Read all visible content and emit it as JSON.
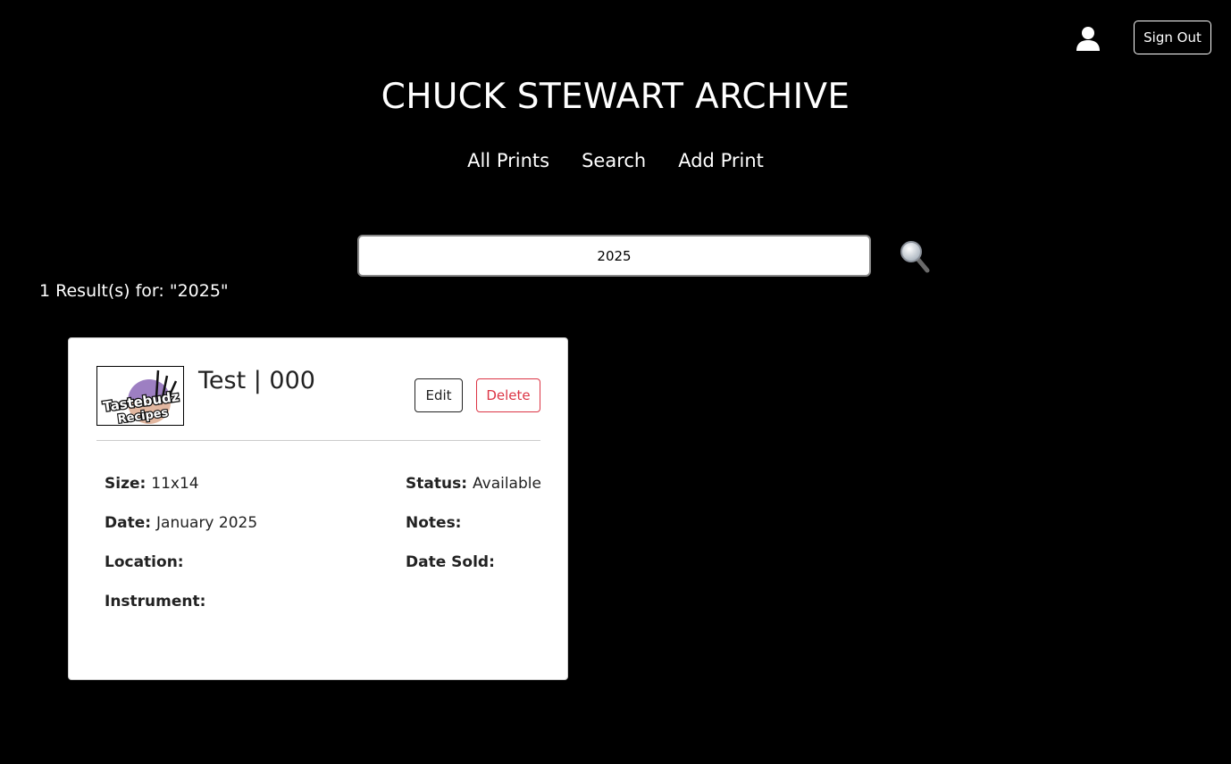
{
  "header": {
    "user_icon": "user-icon",
    "sign_out_label": "Sign Out"
  },
  "site_title": "CHUCK STEWART ARCHIVE",
  "nav": {
    "items": [
      {
        "label": "All Prints"
      },
      {
        "label": "Search"
      },
      {
        "label": "Add Print"
      }
    ]
  },
  "search": {
    "value": "2025",
    "icon": "magnifying-glass-icon"
  },
  "results_text": "1 Result(s) for: \"2025\"",
  "card": {
    "title": "Test | 000",
    "thumbnail_logo_text": [
      "Tastebudz",
      "Recipes"
    ],
    "edit_label": "Edit",
    "delete_label": "Delete",
    "fields": {
      "size": {
        "label": "Size:",
        "value": "11x14"
      },
      "status": {
        "label": "Status:",
        "value": "Available"
      },
      "date": {
        "label": "Date:",
        "value": "January 2025"
      },
      "notes": {
        "label": "Notes:",
        "value": ""
      },
      "location": {
        "label": "Location:",
        "value": ""
      },
      "date_sold": {
        "label": "Date Sold:",
        "value": ""
      },
      "instrument": {
        "label": "Instrument:",
        "value": ""
      }
    }
  },
  "colors": {
    "background": "#000000",
    "card_background": "#ffffff",
    "delete_accent": "#dc3545"
  }
}
